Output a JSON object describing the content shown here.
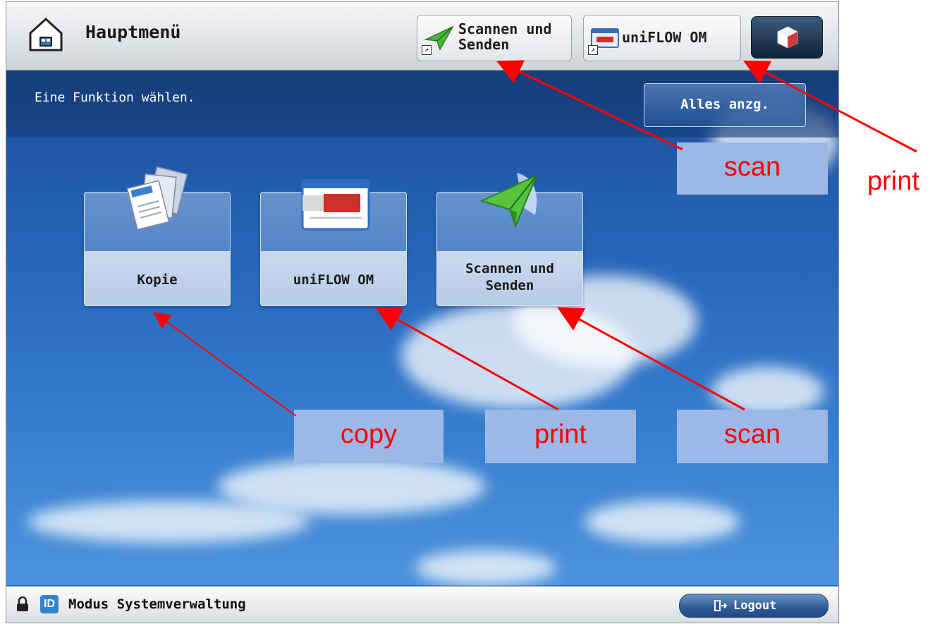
{
  "header": {
    "title": "Hauptmenü",
    "shortcuts": [
      {
        "label": "Scannen und\nSenden",
        "icon": "paper-plane-icon"
      },
      {
        "label": "uniFLOW OM",
        "icon": "uniflow-icon"
      }
    ],
    "system_icon": "settings-cube-icon"
  },
  "main": {
    "instruction": "Eine Funktion wählen.",
    "show_all_label": "Alles anzg.",
    "tiles": [
      {
        "label": "Kopie",
        "icon": "copy-documents-icon"
      },
      {
        "label": "uniFLOW OM",
        "icon": "uniflow-icon"
      },
      {
        "label": "Scannen und\nSenden",
        "icon": "paper-plane-icon"
      }
    ]
  },
  "footer": {
    "mode_label": "Modus Systemverwaltung",
    "id_badge": "ID",
    "logout_label": "Logout"
  },
  "annotations": {
    "scan_top": "scan",
    "print_side": "print",
    "copy": "copy",
    "print_tile": "print",
    "scan_tile": "scan"
  },
  "colors": {
    "annotation_text": "#ff0000",
    "annotation_box": "#9bb8e6",
    "sky": "#2a6cc0"
  }
}
